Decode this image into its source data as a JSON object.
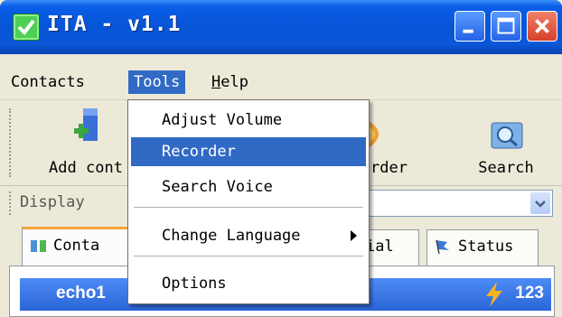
{
  "window": {
    "title": "ITA - v1.1"
  },
  "menubar": {
    "items": [
      {
        "label": "Contacts"
      },
      {
        "label": "Tools"
      },
      {
        "label": "H",
        "rest": "elp"
      }
    ]
  },
  "toolbar": {
    "buttons": [
      {
        "label": "Add cont",
        "icon": "add-contact-icon"
      },
      {
        "label": "rder",
        "icon": "recorder-icon"
      },
      {
        "label": "Search",
        "icon": "search-icon"
      }
    ]
  },
  "display": {
    "label": "Display"
  },
  "tabs": [
    {
      "label": "Conta"
    },
    {
      "label": "ial"
    },
    {
      "label": "Status"
    }
  ],
  "contacts": [
    {
      "name": "echo1",
      "count": "123"
    }
  ],
  "tools_menu": {
    "items": [
      {
        "label": "Adjust Volume"
      },
      {
        "label": "Recorder"
      },
      {
        "label": "Search Voice"
      },
      {
        "label": "Change Language"
      },
      {
        "label": "Options"
      }
    ]
  },
  "colors": {
    "titlebar": "#0754d6",
    "highlight": "#316ac5",
    "tab_accent": "#f2a53a"
  }
}
